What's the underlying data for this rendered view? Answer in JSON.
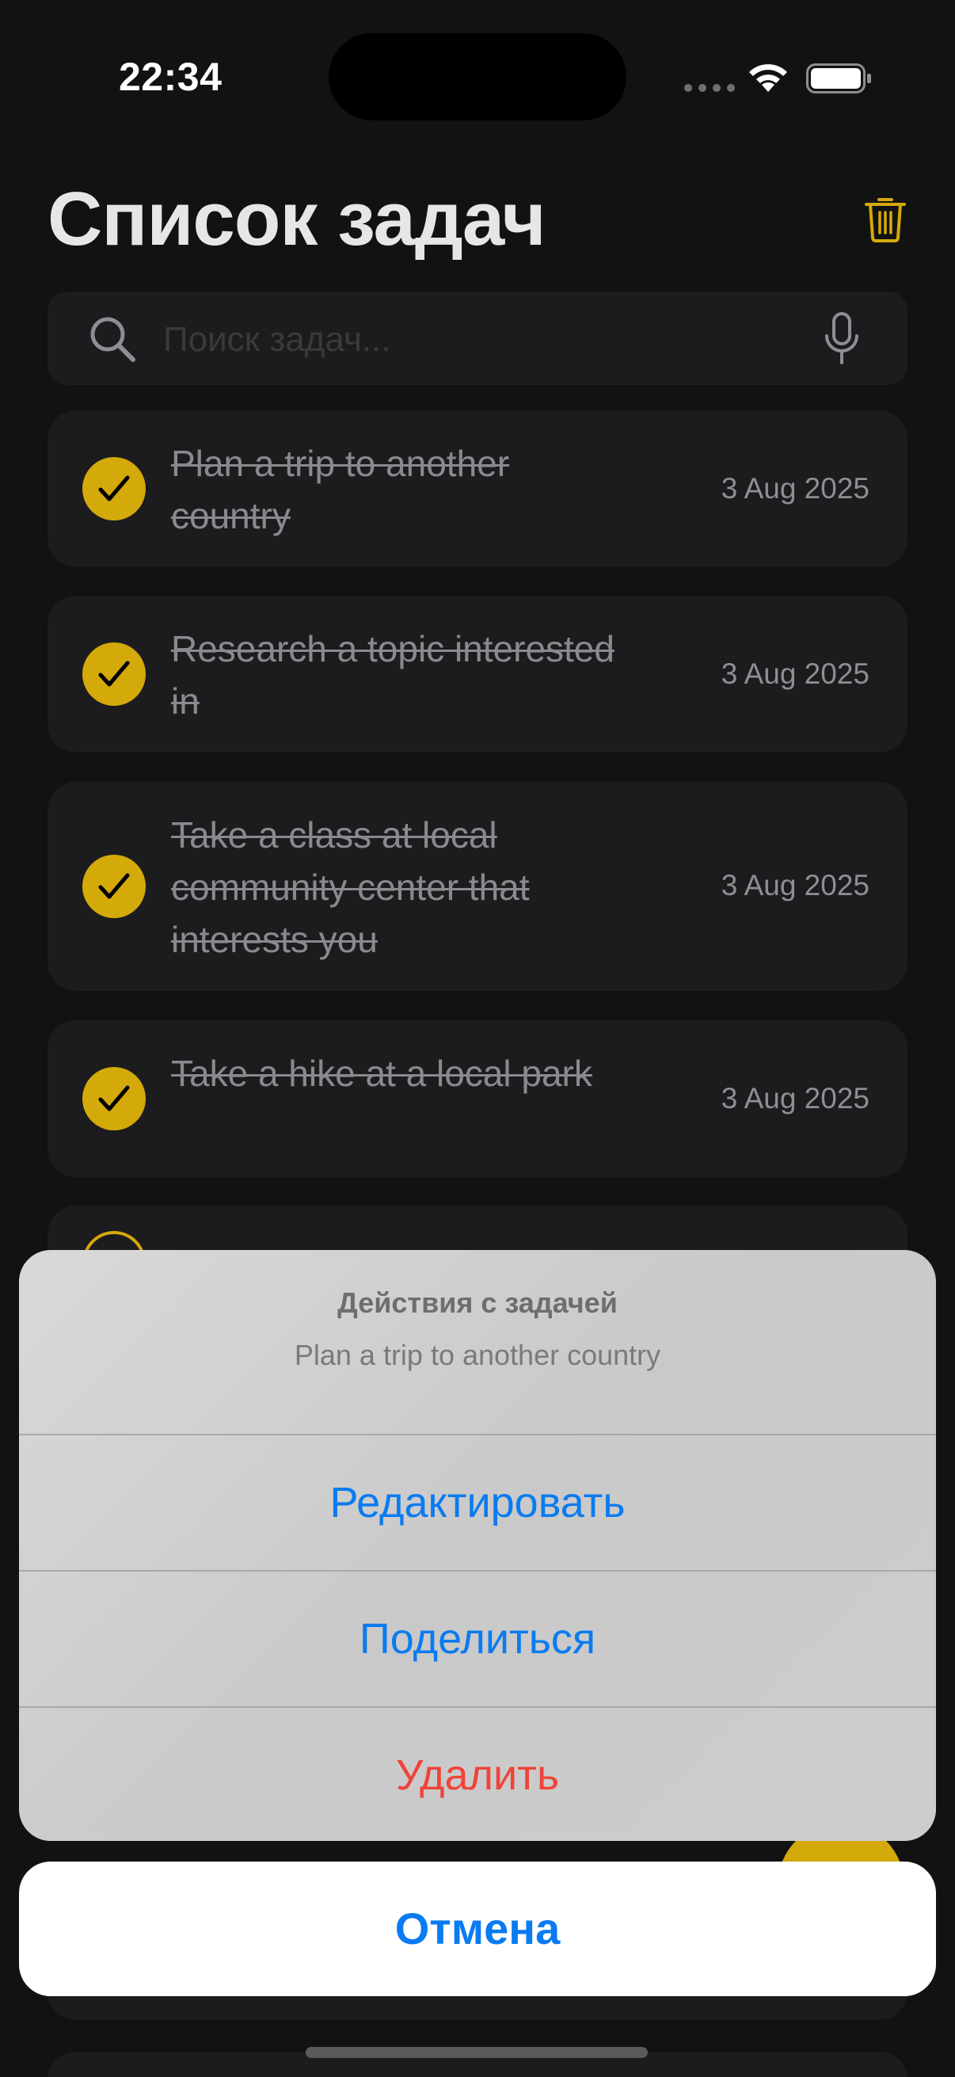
{
  "status_bar": {
    "time": "22:34"
  },
  "header": {
    "title": "Список задач",
    "trash_icon": "trash-icon",
    "accent_color": "#d4a90a"
  },
  "search": {
    "placeholder": "Поиск задач...",
    "icon": "search-icon",
    "mic_icon": "mic-icon"
  },
  "tasks": [
    {
      "title": "Plan a trip to another country",
      "date": "3 Aug 2025",
      "completed": true
    },
    {
      "title": "Research a topic interested in",
      "date": "3 Aug 2025",
      "completed": true
    },
    {
      "title": "Take a class at local community center that interests you",
      "date": "3 Aug 2025",
      "completed": true
    },
    {
      "title": "Take a hike at a local park",
      "date": "3 Aug 2025",
      "completed": true
    }
  ],
  "action_sheet": {
    "title": "Действия с задачей",
    "subtitle": "Plan a trip to another country",
    "actions": {
      "edit": "Редактировать",
      "share": "Поделиться",
      "delete": "Удалить"
    },
    "cancel": "Отмена",
    "colors": {
      "action": "#0a7bf0",
      "destructive": "#f0433a"
    }
  }
}
